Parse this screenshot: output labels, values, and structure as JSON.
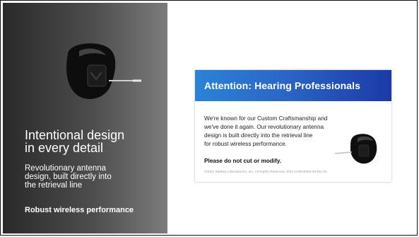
{
  "left_panel": {
    "title": "Intentional design\nin every detail",
    "description": "Revolutionary antenna\ndesign, built directly into\nthe retrieval line",
    "highlight": "Robust wireless performance"
  },
  "card": {
    "title": "Attention: Hearing Professionals",
    "body": "We're known for our Custom Craftsmanship and\nwe've done it again. Our revolutionary antenna\ndesign is built directly into the retrieval line\nfor robust wireless performance.",
    "warning": "Please do not cut or modify.",
    "footer": "©2021 Starkey Laboratories, Inc. All Rights Reserved. 8/21 CARD3003-00-EE-SC"
  },
  "colors": {
    "panel_gradient_start": "#2a2a2a",
    "panel_gradient_end": "#7c7c7c",
    "card_header_start": "#2b83d6",
    "card_header_end": "#1b3aa8"
  },
  "icons": {
    "hero_device": "hearing-aid-icon",
    "card_device": "hearing-aid-icon"
  }
}
